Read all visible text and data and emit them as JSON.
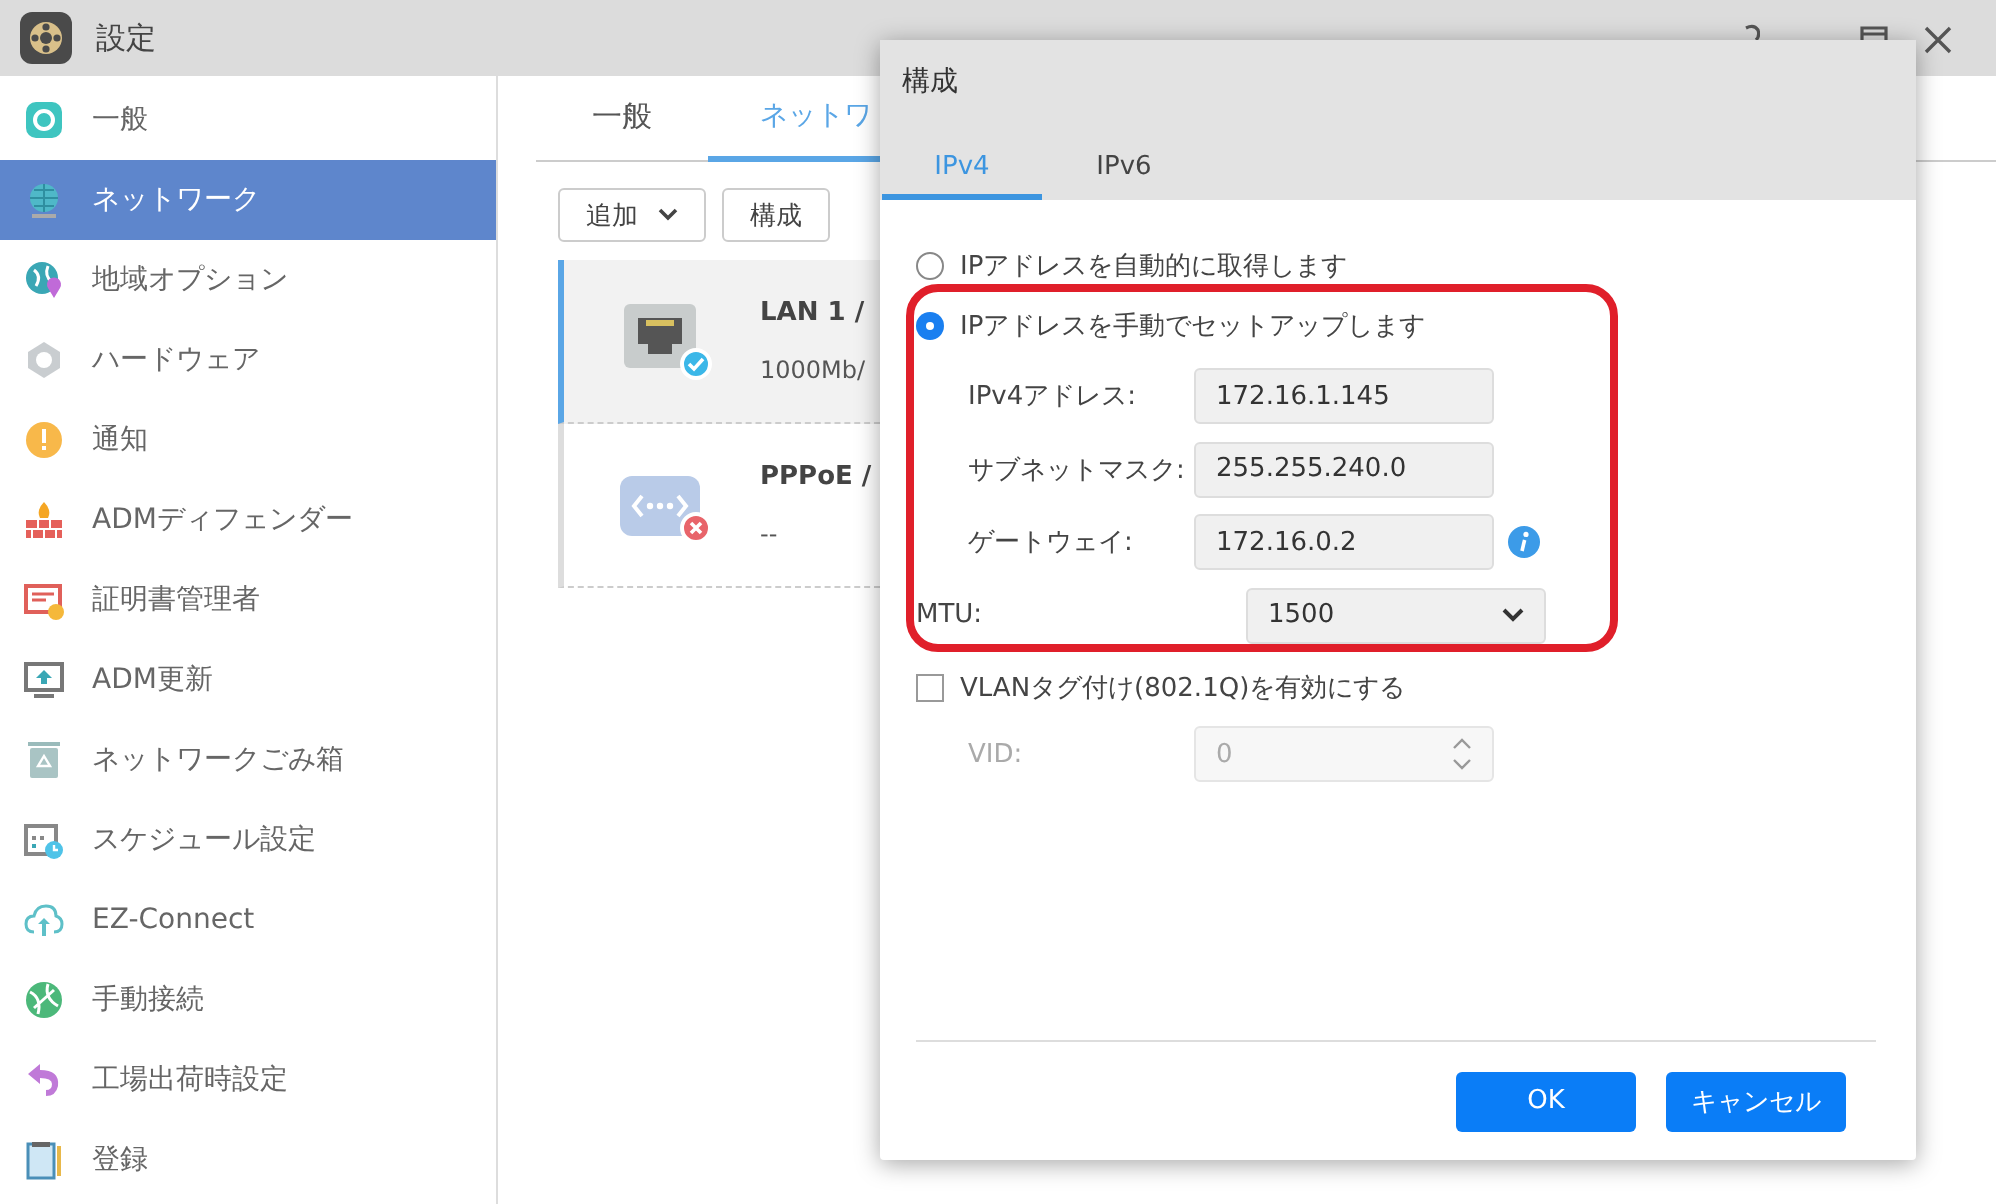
{
  "window": {
    "title": "設定"
  },
  "sidebar": {
    "items": [
      {
        "label": "一般",
        "selected": false
      },
      {
        "label": "ネットワーク",
        "selected": true
      },
      {
        "label": "地域オプション",
        "selected": false
      },
      {
        "label": "ハードウェア",
        "selected": false
      },
      {
        "label": "通知",
        "selected": false
      },
      {
        "label": "ADMディフェンダー",
        "selected": false
      },
      {
        "label": "証明書管理者",
        "selected": false
      },
      {
        "label": "ADM更新",
        "selected": false
      },
      {
        "label": "ネットワークごみ箱",
        "selected": false
      },
      {
        "label": "スケジュール設定",
        "selected": false
      },
      {
        "label": "EZ-Connect",
        "selected": false
      },
      {
        "label": "手動接続",
        "selected": false
      },
      {
        "label": "工場出荷時設定",
        "selected": false
      },
      {
        "label": "登録",
        "selected": false
      }
    ]
  },
  "content": {
    "tabs": [
      {
        "label": "一般",
        "selected": false
      },
      {
        "label": "ネットワ",
        "selected": true
      }
    ],
    "toolbar": [
      {
        "label": "追加",
        "kind": "dropdown"
      },
      {
        "label": "構成",
        "kind": "button"
      }
    ],
    "interfaces": [
      {
        "name": "LAN 1 /",
        "detail": "1000Mb/",
        "kind": "ethernet",
        "connected": true,
        "selected": true
      },
      {
        "name": "PPPoE /",
        "detail": "--",
        "kind": "pppoe",
        "connected": false,
        "selected": false
      }
    ]
  },
  "dialog": {
    "title": "構成",
    "tabs": [
      {
        "label": "IPv4",
        "selected": true
      },
      {
        "label": "IPv6",
        "selected": false
      }
    ],
    "options": [
      {
        "label": "IPアドレスを自動的に取得します",
        "selected": false
      },
      {
        "label": "IPアドレスを手動でセットアップします",
        "selected": true
      }
    ],
    "fields": [
      {
        "label": "IPv4アドレス:",
        "value": "172.16.1.145",
        "kind": "text",
        "info": false
      },
      {
        "label": "サブネットマスク:",
        "value": "255.255.240.0",
        "kind": "text",
        "info": false
      },
      {
        "label": "ゲートウェイ:",
        "value": "172.16.0.2",
        "kind": "text",
        "info": true
      },
      {
        "label": "MTU:",
        "value": "1500",
        "kind": "select",
        "info": false
      }
    ],
    "vlan": {
      "label": "VLANタグ付け(802.1Q)を有効にする",
      "checked": false
    },
    "vid": {
      "label": "VID:",
      "value": "0",
      "disabled": true
    },
    "buttons": [
      "OK",
      "キャンセル"
    ]
  }
}
